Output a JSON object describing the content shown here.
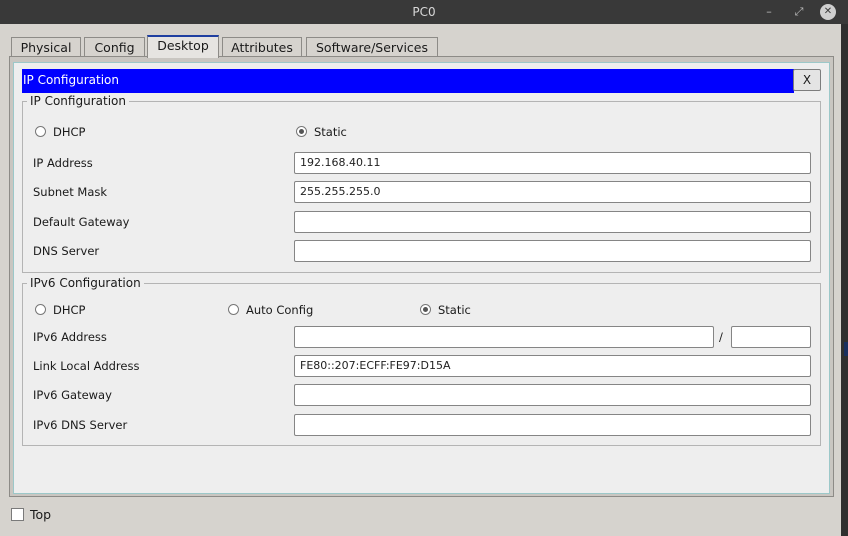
{
  "window": {
    "title": "PC0",
    "controls": {
      "minimize": "–",
      "restore": "⤢",
      "close": "✕"
    }
  },
  "tabs": [
    {
      "label": "Physical",
      "active": false
    },
    {
      "label": "Config",
      "active": false
    },
    {
      "label": "Desktop",
      "active": true
    },
    {
      "label": "Attributes",
      "active": false
    },
    {
      "label": "Software/Services",
      "active": false
    }
  ],
  "app_header": {
    "title": "IP Configuration",
    "close_label": "X"
  },
  "ipv4": {
    "group_label": "IP Configuration",
    "mode_options": [
      {
        "label": "DHCP",
        "selected": false
      },
      {
        "label": "Static",
        "selected": true
      }
    ],
    "ip_address_label": "IP Address",
    "ip_address_value": "192.168.40.11",
    "subnet_mask_label": "Subnet Mask",
    "subnet_mask_value": "255.255.255.0",
    "default_gateway_label": "Default Gateway",
    "default_gateway_value": "",
    "dns_server_label": "DNS Server",
    "dns_server_value": ""
  },
  "ipv6": {
    "group_label": "IPv6 Configuration",
    "mode_options": [
      {
        "label": "DHCP",
        "selected": false
      },
      {
        "label": "Auto Config",
        "selected": false
      },
      {
        "label": "Static",
        "selected": true
      }
    ],
    "address_label": "IPv6 Address",
    "address_value": "",
    "prefix_separator": "/",
    "prefix_value": "",
    "link_local_label": "Link Local Address",
    "link_local_value": "FE80::207:ECFF:FE97:D15A",
    "gateway_label": "IPv6 Gateway",
    "gateway_value": "",
    "dns_server_label": "IPv6 DNS Server",
    "dns_server_value": ""
  },
  "footer": {
    "top_checkbox_label": "Top",
    "top_checked": false
  },
  "colors": {
    "title_bar": "#393939",
    "header_bar": "#0000ff",
    "panel": "#eeeeee",
    "active_tab_border": "#1f3fa0"
  }
}
